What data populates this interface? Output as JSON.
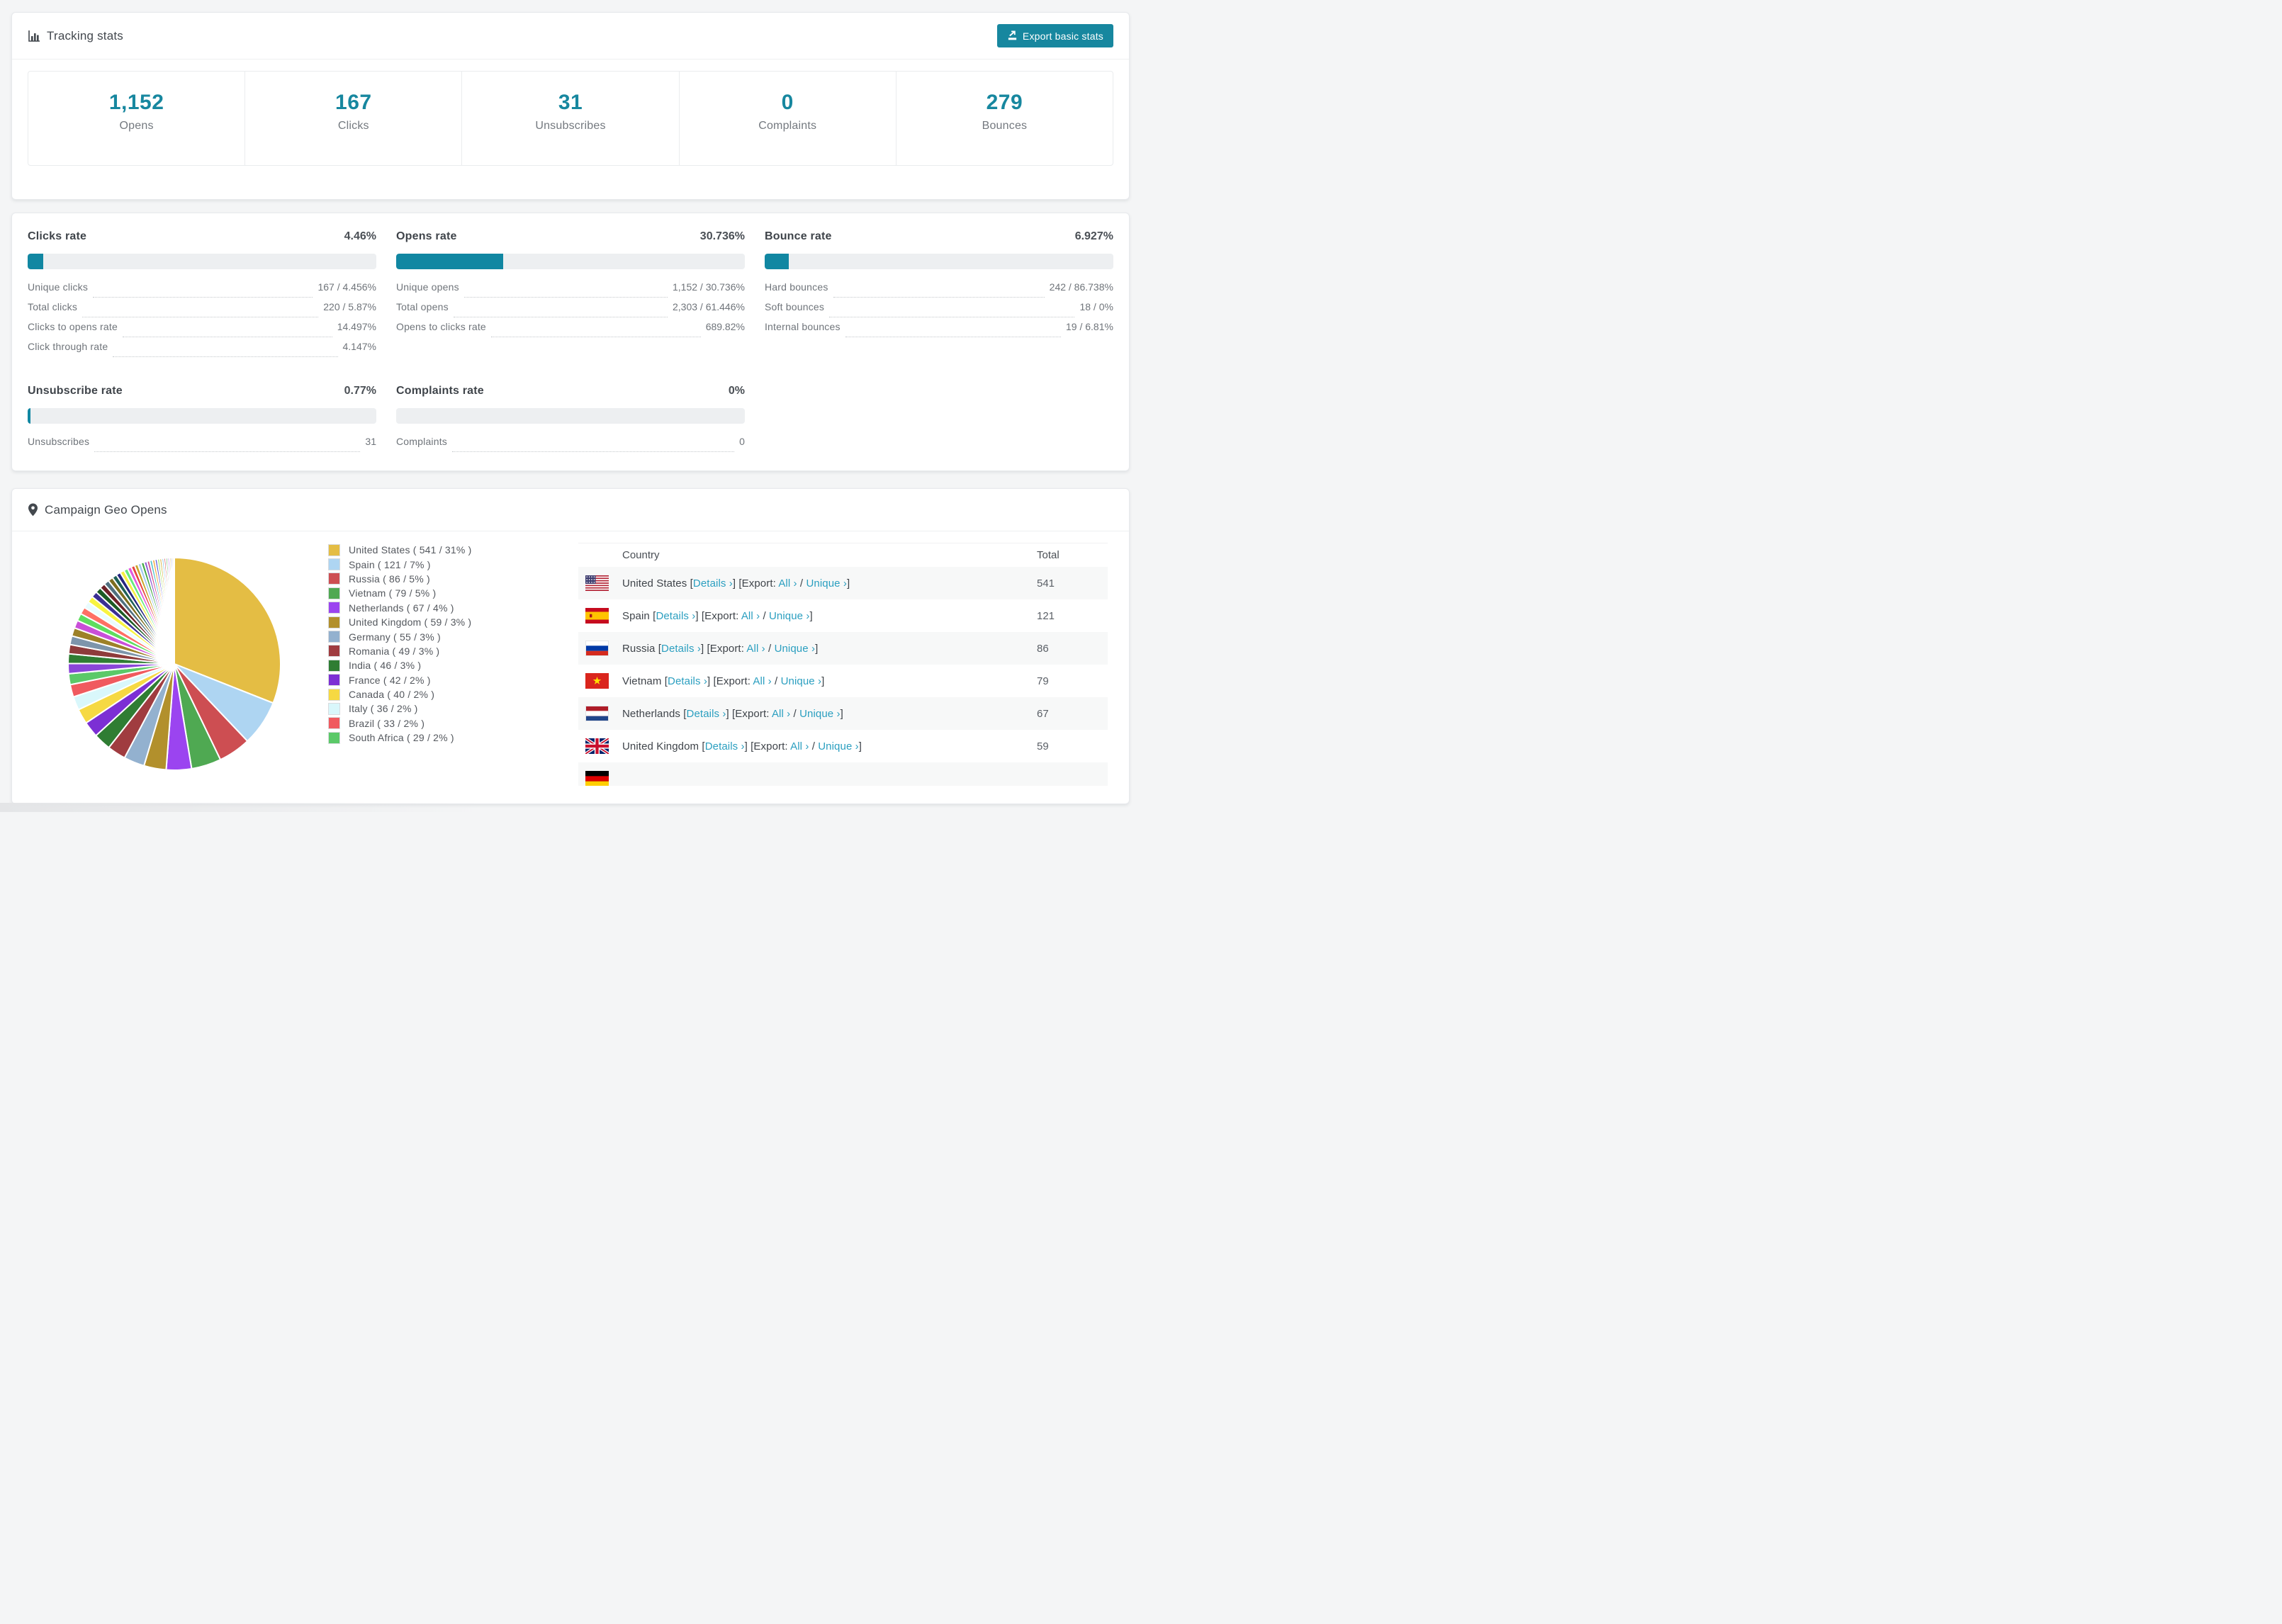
{
  "page": {
    "background": "#f4f5f6",
    "accent": "#17879f",
    "link_color": "#2b9fc0"
  },
  "tracking": {
    "title": "Tracking stats",
    "export_button": "Export basic stats",
    "stats": [
      {
        "value": "1,152",
        "label": "Opens"
      },
      {
        "value": "167",
        "label": "Clicks"
      },
      {
        "value": "31",
        "label": "Unsubscribes"
      },
      {
        "value": "0",
        "label": "Complaints"
      },
      {
        "value": "279",
        "label": "Bounces"
      }
    ]
  },
  "rates": {
    "blocks": [
      {
        "title": "Clicks rate",
        "value": "4.46%",
        "percent": 4.46,
        "rows": [
          {
            "label": "Unique clicks",
            "value": "167 / 4.456%"
          },
          {
            "label": "Total clicks",
            "value": "220 / 5.87%"
          },
          {
            "label": "Clicks to opens rate",
            "value": "14.497%"
          },
          {
            "label": "Click through rate",
            "value": "4.147%"
          }
        ]
      },
      {
        "title": "Opens rate",
        "value": "30.736%",
        "percent": 30.736,
        "rows": [
          {
            "label": "Unique opens",
            "value": "1,152 / 30.736%"
          },
          {
            "label": "Total opens",
            "value": "2,303 / 61.446%"
          },
          {
            "label": "Opens to clicks rate",
            "value": "689.82%"
          }
        ]
      },
      {
        "title": "Bounce rate",
        "value": "6.927%",
        "percent": 6.927,
        "rows": [
          {
            "label": "Hard bounces",
            "value": "242 / 86.738%"
          },
          {
            "label": "Soft bounces",
            "value": "18 / 0%"
          },
          {
            "label": "Internal bounces",
            "value": "19 / 6.81%"
          }
        ]
      },
      {
        "title": "Unsubscribe rate",
        "value": "0.77%",
        "percent": 0.77,
        "rows": [
          {
            "label": "Unsubscribes",
            "value": "31"
          }
        ]
      },
      {
        "title": "Complaints rate",
        "value": "0%",
        "percent": 0,
        "rows": [
          {
            "label": "Complaints",
            "value": "0"
          }
        ]
      }
    ]
  },
  "geo": {
    "title": "Campaign Geo Opens",
    "chart_data": {
      "type": "pie",
      "title": "Campaign Geo Opens",
      "legend_position": "right",
      "legend_format": "{name} ( {value} / {pct}% )",
      "series": [
        {
          "name": "United States",
          "value": 541,
          "pct": 31,
          "color": "#e4bd44"
        },
        {
          "name": "Spain",
          "value": 121,
          "pct": 7,
          "color": "#aed5f2"
        },
        {
          "name": "Russia",
          "value": 86,
          "pct": 5,
          "color": "#cd4e52"
        },
        {
          "name": "Vietnam",
          "value": 79,
          "pct": 5,
          "color": "#4fa952"
        },
        {
          "name": "Netherlands",
          "value": 67,
          "pct": 4,
          "color": "#9b44f0"
        },
        {
          "name": "United Kingdom",
          "value": 59,
          "pct": 3,
          "color": "#b2902c"
        },
        {
          "name": "Germany",
          "value": 55,
          "pct": 3,
          "color": "#93b1cf"
        },
        {
          "name": "Romania",
          "value": 49,
          "pct": 3,
          "color": "#a03c40"
        },
        {
          "name": "India",
          "value": 46,
          "pct": 3,
          "color": "#2f7d33"
        },
        {
          "name": "France",
          "value": 42,
          "pct": 2,
          "color": "#7c2fd4"
        },
        {
          "name": "Canada",
          "value": 40,
          "pct": 2,
          "color": "#f6d943"
        },
        {
          "name": "Italy",
          "value": 36,
          "pct": 2,
          "color": "#d9f7fb"
        },
        {
          "name": "Brazil",
          "value": 33,
          "pct": 2,
          "color": "#f05a5f"
        },
        {
          "name": "South Africa",
          "value": 29,
          "pct": 2,
          "color": "#5bc968"
        }
      ],
      "others_estimated": {
        "count": 38,
        "total": 462
      }
    },
    "table": {
      "headers": [
        "Country",
        "Total"
      ],
      "open_bracket": "[",
      "close_bracket": "]",
      "details_label": "Details ›",
      "export_prefix": "[Export: ",
      "all_label": "All ›",
      "separator": " / ",
      "unique_label": "Unique ›",
      "rows": [
        {
          "flag": "us",
          "country": "United States",
          "total": "541"
        },
        {
          "flag": "es",
          "country": "Spain",
          "total": "121"
        },
        {
          "flag": "ru",
          "country": "Russia",
          "total": "86"
        },
        {
          "flag": "vn",
          "country": "Vietnam",
          "total": "79"
        },
        {
          "flag": "nl",
          "country": "Netherlands",
          "total": "67"
        },
        {
          "flag": "gb",
          "country": "United Kingdom",
          "total": "59"
        },
        {
          "flag": "de",
          "country": "",
          "total": ""
        }
      ]
    }
  }
}
